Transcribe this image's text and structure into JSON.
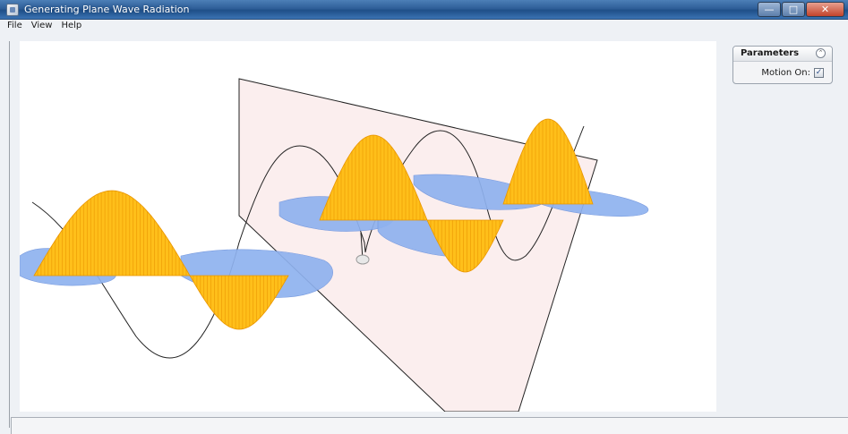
{
  "window": {
    "title": "Generating Plane Wave Radiation",
    "icon": "java-app-icon",
    "buttons": {
      "minimize": "—",
      "maximize": "□",
      "close": "✕"
    }
  },
  "menubar": {
    "items": [
      {
        "label": "File"
      },
      {
        "label": "View"
      },
      {
        "label": "Help"
      }
    ]
  },
  "parameters": {
    "title": "Parameters",
    "collapse_icon": "double-chevron-up-icon",
    "collapse_glyph": "⌃",
    "motion_label": "Motion On:",
    "motion_checked": true,
    "check_glyph": "✓"
  },
  "scene": {
    "colors": {
      "background": "#ffffff",
      "plane_fill": "#fbeeee",
      "plane_edge": "#222222",
      "e_field": "#ffbf1a",
      "e_field_dark": "#e99500",
      "b_field": "#8fb2ef",
      "b_field_dark": "#6e93dc",
      "charge": "#e8e8e8"
    }
  }
}
